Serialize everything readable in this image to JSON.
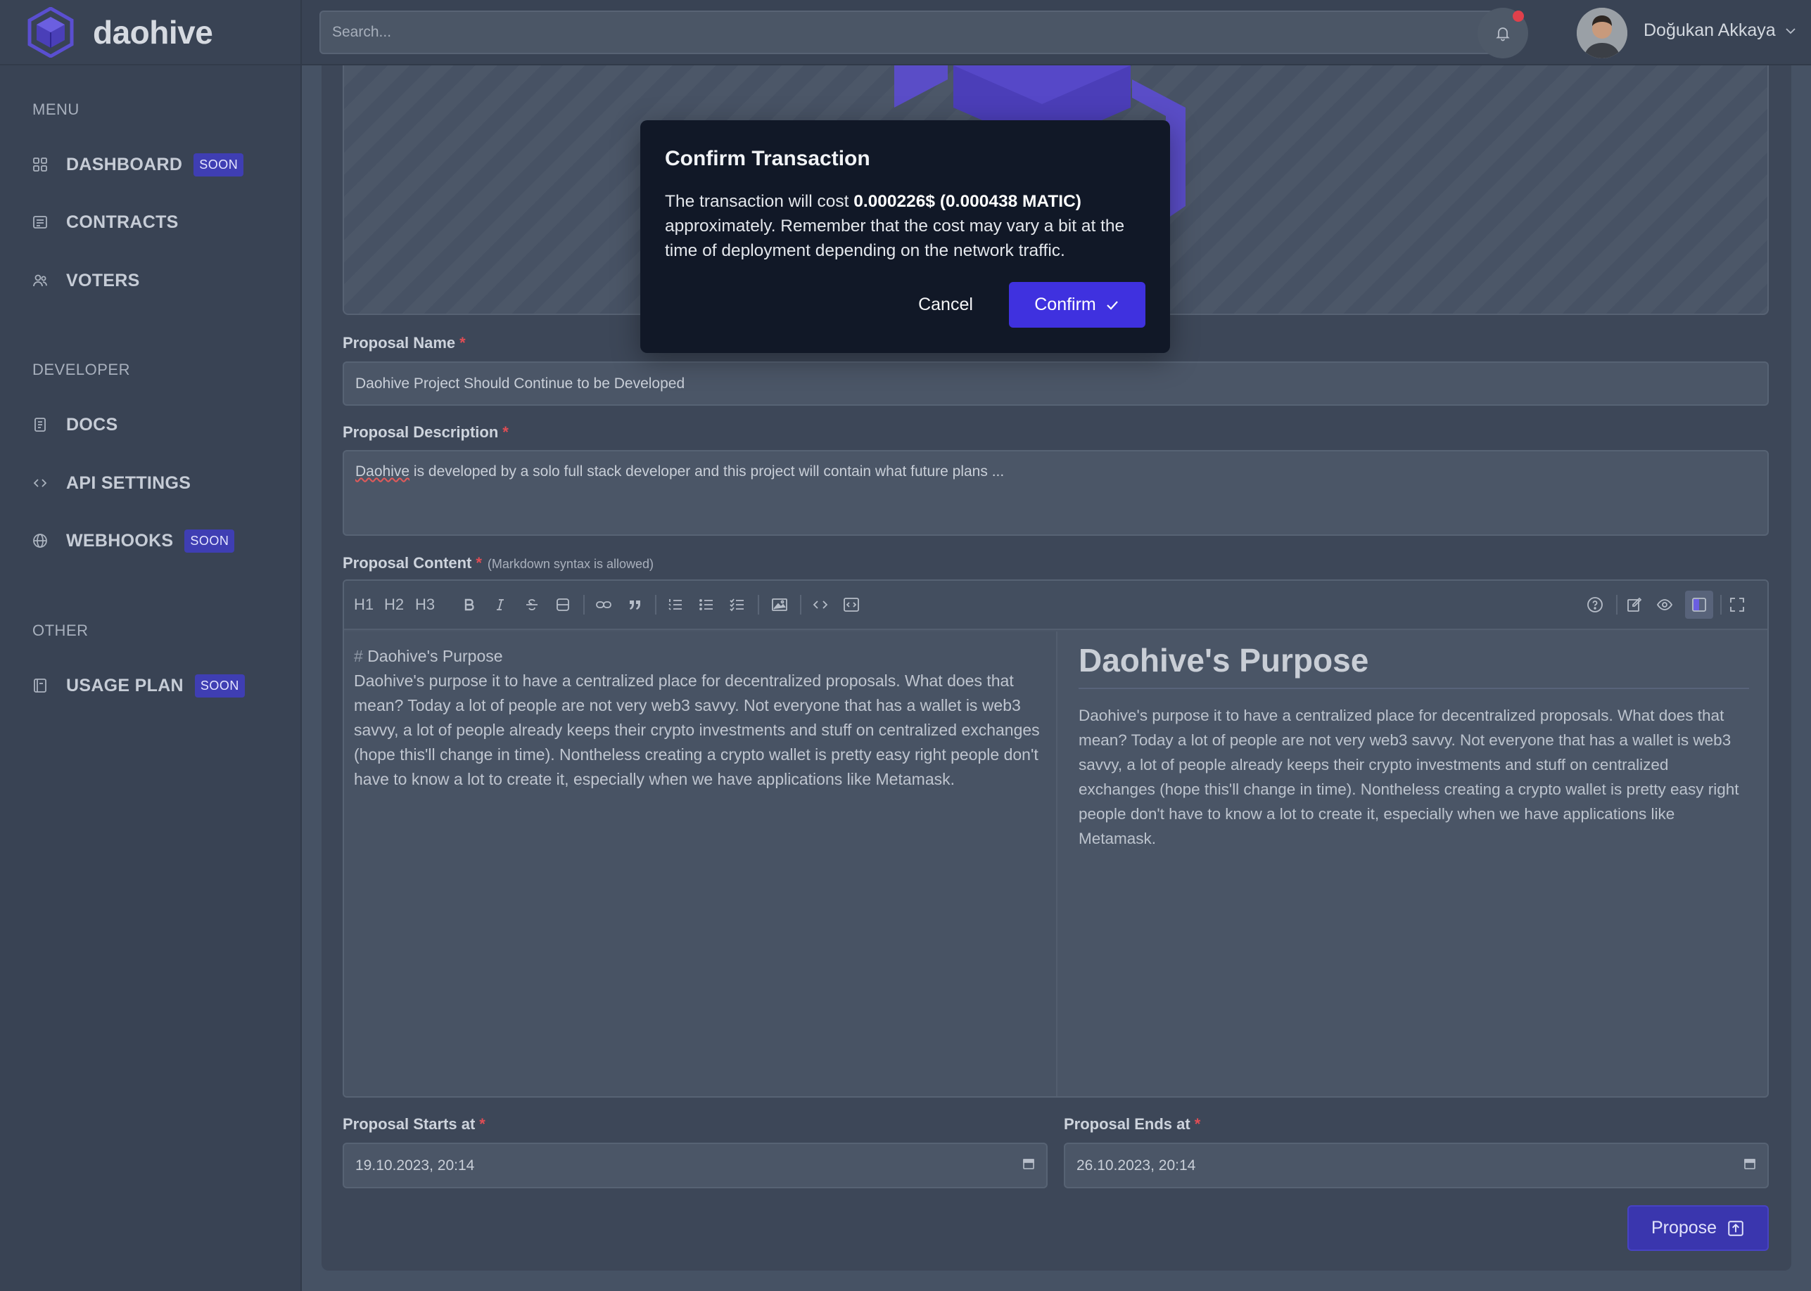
{
  "brand": {
    "name": "daohive"
  },
  "sidebar": {
    "sections": [
      {
        "title": "MENU"
      },
      {
        "title": "DEVELOPER"
      },
      {
        "title": "OTHER"
      }
    ],
    "items": [
      {
        "label": "DASHBOARD",
        "badge": "SOON",
        "icon": "grid-icon"
      },
      {
        "label": "CONTRACTS",
        "icon": "contract-icon"
      },
      {
        "label": "VOTERS",
        "icon": "users-icon"
      },
      {
        "label": "DOCS",
        "icon": "document-icon"
      },
      {
        "label": "API SETTINGS",
        "icon": "code-icon"
      },
      {
        "label": "WEBHOOKS",
        "badge": "SOON",
        "icon": "globe-icon"
      },
      {
        "label": "USAGE PLAN",
        "badge": "SOON",
        "icon": "plan-icon"
      }
    ]
  },
  "topbar": {
    "search_placeholder": "Search...",
    "user_name": "Doğukan Akkaya"
  },
  "form": {
    "name_label": "Proposal Name",
    "name_value": "Daohive Project Should Continue to be Developed",
    "desc_label": "Proposal Description",
    "desc_value_word": "Daohive",
    "desc_value_rest": " is developed by a solo full stack developer and this project will contain what future plans ...",
    "content_label": "Proposal Content",
    "content_hint": "(Markdown syntax is allowed)",
    "starts_label": "Proposal Starts at",
    "starts_value": "19.10.2023, 20:14",
    "ends_label": "Proposal Ends at",
    "ends_value": "26.10.2023, 20:14",
    "submit_label": "Propose",
    "required_mark": "*"
  },
  "editor": {
    "toolbar": [
      "H1",
      "H2",
      "H3"
    ],
    "markdown_hash": "#",
    "markdown_heading": "Daohive's Purpose",
    "markdown_body": "Daohive's purpose it to have a centralized place for decentralized proposals. What does that mean? Today a lot of people are not very web3 savvy. Not everyone that has a wallet is web3 savvy, a lot of people already keeps their crypto investments and stuff on centralized exchanges (hope this'll change in time). Nontheless creating a crypto wallet is pretty easy right people don't have to know a lot to create it, especially when we have applications like Metamask.",
    "preview_heading": "Daohive's Purpose",
    "preview_body": "Daohive's purpose it to have a centralized place for decentralized proposals. What does that mean? Today a lot of people are not very web3 savvy. Not everyone that has a wallet is web3 savvy, a lot of people already keeps their crypto investments and stuff on centralized exchanges (hope this'll change in time). Nontheless creating a crypto wallet is pretty easy right people don't have to know a lot to create it, especially when we have applications like Metamask."
  },
  "modal": {
    "title": "Confirm Transaction",
    "text_before": "The transaction will cost ",
    "cost": "0.000226$ (0.000438 MATIC)",
    "text_after": " approximately. Remember that the cost may vary a bit at the time of deployment depending on the network traffic.",
    "cancel_label": "Cancel",
    "confirm_label": "Confirm"
  },
  "colors": {
    "accent": "#3f31df",
    "badge": "#3f3eb3",
    "required": "#e14d54",
    "notification_dot": "#e0404b"
  }
}
